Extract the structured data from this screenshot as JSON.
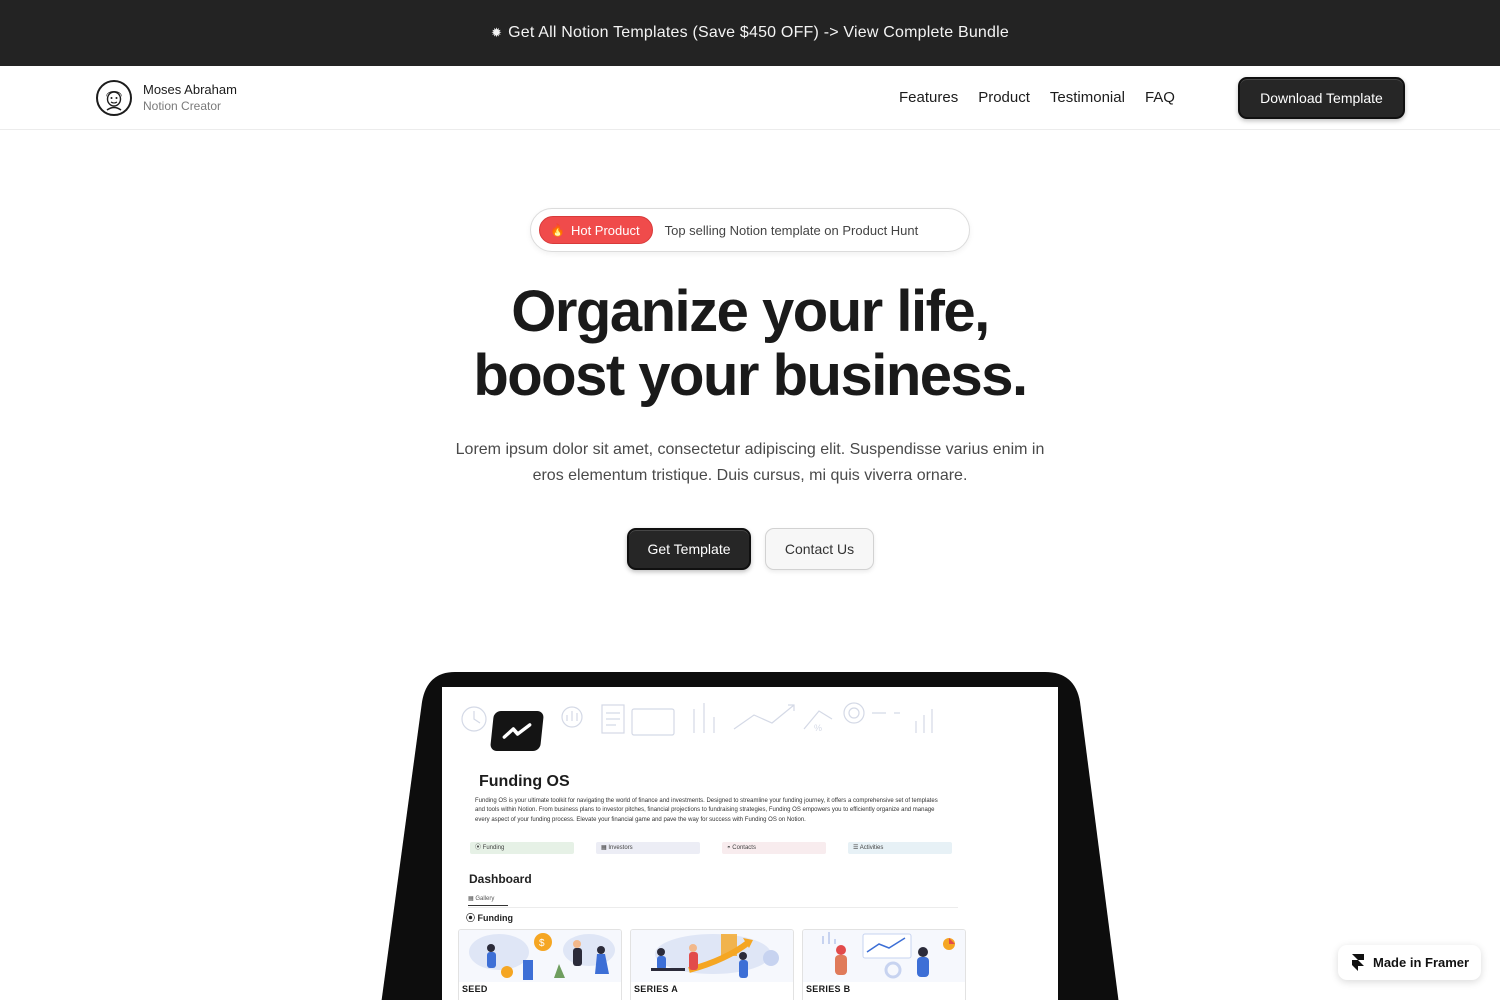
{
  "announcement": {
    "icon": "sparkle-icon",
    "text": "Get All Notion Templates (Save $450 OFF) -> View Complete Bundle"
  },
  "nav": {
    "brand_name": "Moses Abraham",
    "brand_role": "Notion Creator",
    "links": [
      "Features",
      "Product",
      "Testimonial",
      "FAQ"
    ],
    "cta": "Download Template"
  },
  "hero": {
    "badge_label": "Hot Product",
    "badge_icon": "fire-icon",
    "badge_text": "Top selling Notion template on Product Hunt",
    "title_line1": "Organize your life,",
    "title_line2": "boost your business.",
    "description": "Lorem ipsum dolor sit amet, consectetur adipiscing elit. Suspendisse varius enim in eros elementum tristique. Duis cursus, mi quis viverra ornare.",
    "primary_cta": "Get Template",
    "secondary_cta": "Contact Us"
  },
  "preview": {
    "title": "Funding OS",
    "description": "Funding OS is your ultimate toolkit for navigating the world of finance and investments. Designed to streamline your funding journey, it offers a comprehensive set of templates and tools within Notion. From business plans to investor pitches, financial projections to fundraising strategies, Funding OS empowers you to efficiently organize and manage every aspect of your funding process. Elevate your financial game and pave the way for success with Funding OS on Notion.",
    "chips": [
      {
        "label": "Funding",
        "color": "#e6f1e6"
      },
      {
        "label": "Investors",
        "color": "#ecedf5"
      },
      {
        "label": "Contacts",
        "color": "#f8ecee"
      },
      {
        "label": "Activities",
        "color": "#e7f1f6"
      }
    ],
    "dashboard_heading": "Dashboard",
    "gallery_tab": "Gallery",
    "section_heading": "Funding",
    "cards": [
      "SEED",
      "SERIES A",
      "SERIES B"
    ]
  },
  "framer_badge": "Made in Framer",
  "colors": {
    "announcement_bg": "#232323",
    "primary_button": "#262626",
    "hot_badge": "#f04b4b",
    "accent_orange": "#f5a623",
    "accent_blue": "#3d6fd6"
  }
}
